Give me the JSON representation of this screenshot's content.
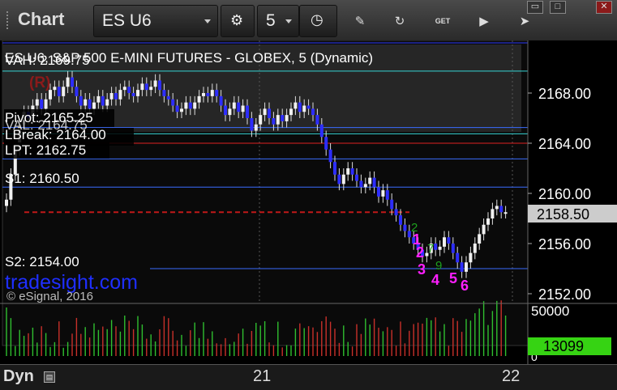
{
  "toolbar": {
    "title": "Chart",
    "symbol": "ES U6",
    "interval": "5",
    "icons": [
      "settings-icon",
      "clock-icon",
      "pencil-icon",
      "refresh-icon",
      "get-icon",
      "play-icon",
      "cursor-icon"
    ],
    "window_buttons": [
      "restore-icon",
      "maximize-icon",
      "close-icon"
    ]
  },
  "chart_data": {
    "type": "candlestick",
    "title": "ES U6, S&P 500 E-MINI FUTURES - GLOBEX, 5 (Dynamic)",
    "ylim": [
      2150.5,
      2171.5
    ],
    "y_ticks": [
      "2168.00",
      "2164.00",
      "2160.00",
      "2156.00",
      "2152.00"
    ],
    "y_tick_values": [
      2168,
      2164,
      2160,
      2156,
      2152
    ],
    "x_labels": [
      "21",
      "22"
    ],
    "last_price": "2158.50",
    "levels": [
      {
        "label": "VAH: 2169.75",
        "value": 2169.75,
        "color": "#37d5d5"
      },
      {
        "label": "Pivot: 2165.25",
        "value": 2165.25,
        "color": "#3a6cff"
      },
      {
        "label": "VAL: 2164.75",
        "value": 2164.75,
        "color": "#37d5d5"
      },
      {
        "label": "LBreak: 2164.00",
        "value": 2164.0,
        "color": "#d22"
      },
      {
        "label": "LPT: 2162.75",
        "value": 2162.75,
        "color": "#3a6cff"
      },
      {
        "label": "S1: 2160.50",
        "value": 2160.5,
        "color": "#3a6cff"
      },
      {
        "label": "S2: 2154.00",
        "value": 2154.0,
        "color": "#3a6cff"
      }
    ],
    "dashed_level": 2158.5,
    "top_level": 2172.0,
    "markers": {
      "R": "(R)",
      "magenta": [
        "1",
        "2",
        "3",
        "4",
        "5",
        "6"
      ],
      "green": [
        "2",
        "7",
        "9"
      ]
    },
    "volume": {
      "axis_top": "50000",
      "axis_zero": "0",
      "last": "13099"
    },
    "watermark": "tradesight.com",
    "copyright": "© eSignal, 2016",
    "bottom_label": "Dyn",
    "closes": [
      2159.5,
      2161.5,
      2163.5,
      2165.5,
      2166.5,
      2166.0,
      2167.0,
      2167.5,
      2166.75,
      2167.5,
      2168.25,
      2168.5,
      2167.75,
      2168.5,
      2169.25,
      2168.5,
      2167.75,
      2167.0,
      2167.5,
      2166.75,
      2167.25,
      2167.75,
      2167.0,
      2167.5,
      2168.0,
      2167.5,
      2168.25,
      2168.5,
      2168.0,
      2167.75,
      2168.25,
      2168.75,
      2168.25,
      2168.5,
      2169.0,
      2168.25,
      2167.75,
      2167.5,
      2167.0,
      2166.5,
      2166.75,
      2167.25,
      2166.75,
      2167.25,
      2167.75,
      2168.0,
      2167.75,
      2168.25,
      2167.75,
      2167.0,
      2166.25,
      2166.75,
      2167.25,
      2166.5,
      2167.0,
      2166.0,
      2165.0,
      2165.5,
      2166.25,
      2166.75,
      2166.0,
      2165.5,
      2166.25,
      2165.75,
      2166.25,
      2166.75,
      2167.25,
      2166.5,
      2167.0,
      2166.75,
      2166.25,
      2165.5,
      2164.5,
      2163.5,
      2162.5,
      2161.5,
      2160.75,
      2161.5,
      2162.0,
      2161.5,
      2161.0,
      2160.5,
      2160.75,
      2161.25,
      2160.5,
      2159.75,
      2160.25,
      2159.5,
      2158.75,
      2158.25,
      2157.5,
      2157.0,
      2156.5,
      2156.0,
      2155.5,
      2155.0,
      2155.25,
      2156.0,
      2155.5,
      2155.75,
      2156.5,
      2156.0,
      2155.25,
      2154.5,
      2153.75,
      2154.5,
      2155.25,
      2156.0,
      2156.75,
      2157.5,
      2158.0,
      2158.75,
      2159.0,
      2158.5,
      2158.5
    ]
  },
  "bottom": {
    "dyn": "Dyn",
    "day21": "21",
    "day22": "22"
  }
}
